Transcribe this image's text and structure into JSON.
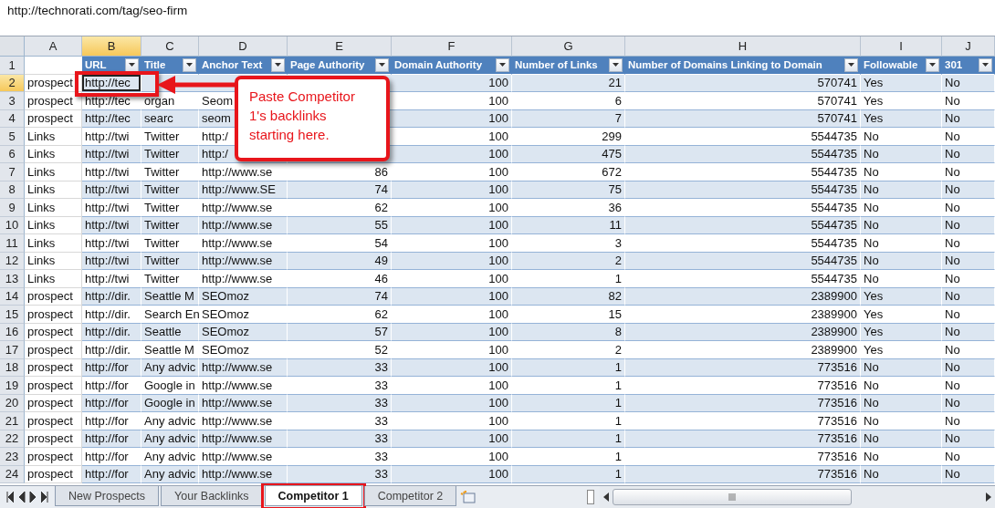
{
  "formula_bar": {
    "value": "http://technorati.com/tag/seo-firm"
  },
  "columns": [
    {
      "letter": "A",
      "kind": "text",
      "selected": false
    },
    {
      "letter": "B",
      "header": "URL",
      "kind": "text",
      "selected": true
    },
    {
      "letter": "C",
      "header": "Title",
      "kind": "text",
      "selected": false
    },
    {
      "letter": "D",
      "header": "Anchor Text",
      "kind": "text",
      "selected": false
    },
    {
      "letter": "E",
      "header": "Page Authority",
      "kind": "number",
      "selected": false
    },
    {
      "letter": "F",
      "header": "Domain Authority",
      "kind": "number",
      "selected": false
    },
    {
      "letter": "G",
      "header": "Number of Links",
      "kind": "number",
      "selected": false
    },
    {
      "letter": "H",
      "header": "Number of Domains Linking to Domain",
      "kind": "number",
      "selected": false
    },
    {
      "letter": "I",
      "header": "Followable",
      "kind": "text",
      "selected": false
    },
    {
      "letter": "J",
      "header": "301",
      "kind": "text",
      "selected": false
    }
  ],
  "header_row": {
    "number": "1",
    "selected": false
  },
  "rows": [
    {
      "number": "2",
      "selected": true,
      "cells": [
        "prospect",
        "http://tec",
        null,
        null,
        null,
        "100",
        "21",
        "570741",
        "Yes",
        "No"
      ]
    },
    {
      "number": "3",
      "selected": false,
      "cells": [
        "prospect",
        "http://tec",
        "organ",
        "Seom",
        null,
        "100",
        "6",
        "570741",
        "Yes",
        "No"
      ]
    },
    {
      "number": "4",
      "selected": false,
      "cells": [
        "prospect",
        "http://tec",
        "searc",
        "seom",
        null,
        "100",
        "7",
        "570741",
        "Yes",
        "No"
      ]
    },
    {
      "number": "5",
      "selected": false,
      "cells": [
        "Links",
        "http://twi",
        "Twitter",
        "http:/",
        null,
        "100",
        "299",
        "5544735",
        "No",
        "No"
      ]
    },
    {
      "number": "6",
      "selected": false,
      "cells": [
        "Links",
        "http://twi",
        "Twitter",
        "http:/",
        null,
        "100",
        "475",
        "5544735",
        "No",
        "No"
      ]
    },
    {
      "number": "7",
      "selected": false,
      "cells": [
        "Links",
        "http://twi",
        "Twitter",
        "http://www.se",
        "86",
        "100",
        "672",
        "5544735",
        "No",
        "No"
      ]
    },
    {
      "number": "8",
      "selected": false,
      "cells": [
        "Links",
        "http://twi",
        "Twitter",
        "http://www.SE",
        "74",
        "100",
        "75",
        "5544735",
        "No",
        "No"
      ]
    },
    {
      "number": "9",
      "selected": false,
      "cells": [
        "Links",
        "http://twi",
        "Twitter",
        "http://www.se",
        "62",
        "100",
        "36",
        "5544735",
        "No",
        "No"
      ]
    },
    {
      "number": "10",
      "selected": false,
      "cells": [
        "Links",
        "http://twi",
        "Twitter",
        "http://www.se",
        "55",
        "100",
        "11",
        "5544735",
        "No",
        "No"
      ]
    },
    {
      "number": "11",
      "selected": false,
      "cells": [
        "Links",
        "http://twi",
        "Twitter",
        "http://www.se",
        "54",
        "100",
        "3",
        "5544735",
        "No",
        "No"
      ]
    },
    {
      "number": "12",
      "selected": false,
      "cells": [
        "Links",
        "http://twi",
        "Twitter",
        "http://www.se",
        "49",
        "100",
        "2",
        "5544735",
        "No",
        "No"
      ]
    },
    {
      "number": "13",
      "selected": false,
      "cells": [
        "Links",
        "http://twi",
        "Twitter",
        "http://www.se",
        "46",
        "100",
        "1",
        "5544735",
        "No",
        "No"
      ]
    },
    {
      "number": "14",
      "selected": false,
      "cells": [
        "prospect",
        "http://dir.",
        "Seattle M",
        "SEOmoz",
        "74",
        "100",
        "82",
        "2389900",
        "Yes",
        "No"
      ]
    },
    {
      "number": "15",
      "selected": false,
      "cells": [
        "prospect",
        "http://dir.",
        "Search En",
        "SEOmoz",
        "62",
        "100",
        "15",
        "2389900",
        "Yes",
        "No"
      ]
    },
    {
      "number": "16",
      "selected": false,
      "cells": [
        "prospect",
        "http://dir.",
        "Seattle",
        "SEOmoz",
        "57",
        "100",
        "8",
        "2389900",
        "Yes",
        "No"
      ]
    },
    {
      "number": "17",
      "selected": false,
      "cells": [
        "prospect",
        "http://dir.",
        "Seattle M",
        "SEOmoz",
        "52",
        "100",
        "2",
        "2389900",
        "Yes",
        "No"
      ]
    },
    {
      "number": "18",
      "selected": false,
      "cells": [
        "prospect",
        "http://for",
        "Any advic",
        "http://www.se",
        "33",
        "100",
        "1",
        "773516",
        "No",
        "No"
      ]
    },
    {
      "number": "19",
      "selected": false,
      "cells": [
        "prospect",
        "http://for",
        "Google in",
        "http://www.se",
        "33",
        "100",
        "1",
        "773516",
        "No",
        "No"
      ]
    },
    {
      "number": "20",
      "selected": false,
      "cells": [
        "prospect",
        "http://for",
        "Google in",
        "http://www.se",
        "33",
        "100",
        "1",
        "773516",
        "No",
        "No"
      ]
    },
    {
      "number": "21",
      "selected": false,
      "cells": [
        "prospect",
        "http://for",
        "Any advic",
        "http://www.se",
        "33",
        "100",
        "1",
        "773516",
        "No",
        "No"
      ]
    },
    {
      "number": "22",
      "selected": false,
      "cells": [
        "prospect",
        "http://for",
        "Any advic",
        "http://www.se",
        "33",
        "100",
        "1",
        "773516",
        "No",
        "No"
      ]
    },
    {
      "number": "23",
      "selected": false,
      "cells": [
        "prospect",
        "http://for",
        "Any advic",
        "http://www.se",
        "33",
        "100",
        "1",
        "773516",
        "No",
        "No"
      ]
    },
    {
      "number": "24",
      "selected": false,
      "cells": [
        "prospect",
        "http://for",
        "Any advic",
        "http://www.se",
        "33",
        "100",
        "1",
        "773516",
        "No",
        "No"
      ]
    }
  ],
  "annotation": {
    "text": "Paste Competitor 1's backlinks starting here."
  },
  "sheet_tabs": [
    {
      "label": "New Prospects",
      "selected": false,
      "highlighted": false
    },
    {
      "label": "Your Backlinks",
      "selected": false,
      "highlighted": false
    },
    {
      "label": "Competitor 1",
      "selected": true,
      "highlighted": true
    },
    {
      "label": "Competitor 2",
      "selected": false,
      "highlighted": false
    }
  ]
}
